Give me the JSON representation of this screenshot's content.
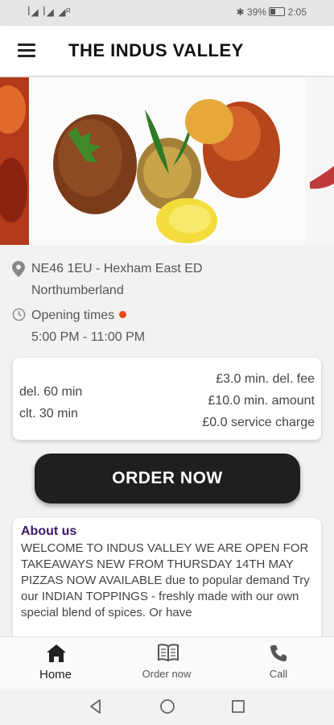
{
  "status_bar": {
    "left": "ꟾ◢ ꟾ◢ ◢ᴿ",
    "battery": "39%",
    "time": "2:05"
  },
  "header": {
    "title": "THE INDUS VALLEY",
    "menu_icon": "hamburger-menu-icon"
  },
  "location": {
    "line1": "NE46 1EU - Hexham East ED",
    "line2": "Northumberland",
    "icon": "map-pin-icon"
  },
  "opening": {
    "label": "Opening times",
    "hours": "5:00 PM - 11:00 PM",
    "icon": "clock-icon",
    "status_color": "#e8491d"
  },
  "delivery": {
    "del_time": "del. 60 min",
    "clt_time": "clt. 30 min",
    "min_fee": "£3.0 min. del. fee",
    "min_amount": "£10.0 min. amount",
    "service": "£0.0 service charge"
  },
  "order_button": "ORDER NOW",
  "about": {
    "title": "About us",
    "text": "WELCOME TO INDUS VALLEY  WE ARE OPEN FOR TAKEAWAYS  NEW FROM THURSDAY 14TH MAY PIZZAS NOW AVAILABLE due to popular demand  Try our INDIAN TOPPINGS - freshly made with our own special blend of spices. Or have"
  },
  "bottom_nav": [
    {
      "label": "Home",
      "icon": "home-icon",
      "active": true
    },
    {
      "label": "Order now",
      "icon": "menu-book-icon",
      "active": false
    },
    {
      "label": "Call",
      "icon": "phone-icon",
      "active": false
    }
  ],
  "system_nav": [
    "back-icon",
    "home-circle-icon",
    "recents-icon"
  ]
}
